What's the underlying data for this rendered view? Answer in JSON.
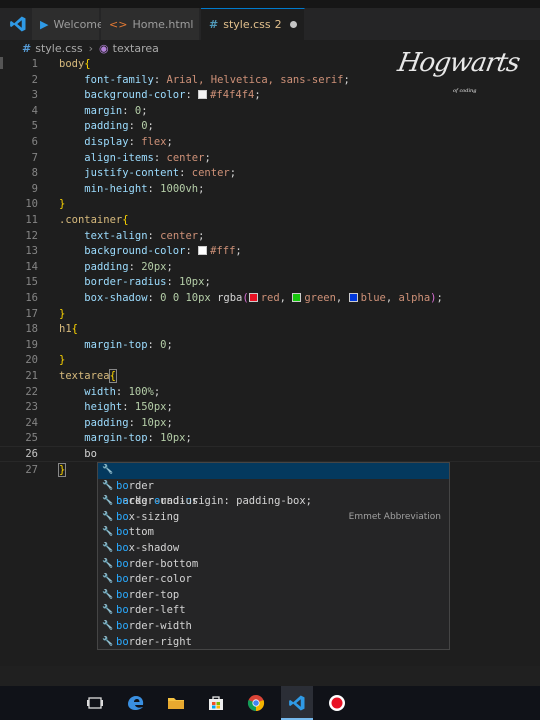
{
  "tabs": [
    {
      "label": "Welcome",
      "icon": "vscode-icon",
      "active": false
    },
    {
      "label": "Home.html",
      "icon": "html-icon",
      "active": false,
      "dirty": true
    },
    {
      "label": "style.css",
      "icon": "css-icon",
      "active": true,
      "badge": "2",
      "dirty": true
    }
  ],
  "breadcrumb": {
    "file": "style.css",
    "symbol": "textarea"
  },
  "watermark": {
    "title": "Hogwarts",
    "subtitle": "of coding"
  },
  "suggest": {
    "detail": "Emmet Abbreviation",
    "items": [
      {
        "prefix": "back",
        "hl": "",
        "rest": "ground-",
        "hl2": "o",
        "rest2": "rigin: padding-box;",
        "full": "background-origin: padding-box;"
      },
      {
        "hl": "bo",
        "rest": "rder"
      },
      {
        "hl": "bo",
        "rest": "rder-radius"
      },
      {
        "hl": "bo",
        "rest": "x-sizing"
      },
      {
        "hl": "bo",
        "rest": "ttom"
      },
      {
        "hl": "bo",
        "rest": "x-shadow"
      },
      {
        "hl": "bo",
        "rest": "rder-bottom"
      },
      {
        "hl": "bo",
        "rest": "rder-color"
      },
      {
        "hl": "bo",
        "rest": "rder-top"
      },
      {
        "hl": "bo",
        "rest": "rder-left"
      },
      {
        "hl": "bo",
        "rest": "rder-width"
      },
      {
        "hl": "bo",
        "rest": "rder-right"
      }
    ]
  },
  "code": {
    "l1": "body{",
    "l2p": "font-family",
    "l2v": "Arial, Helvetica, sans-serif",
    "l3p": "background-color",
    "l3v": "#f4f4f4",
    "l4p": "margin",
    "l4v": "0",
    "l5p": "padding",
    "l5v": "0",
    "l6p": "display",
    "l6v": "flex",
    "l7p": "align-items",
    "l7v": "center",
    "l8p": "justify-content",
    "l8v": "center",
    "l9p": "min-height",
    "l9v": "1000vh",
    "l10": "}",
    "l11": ".container{",
    "l12p": "text-align",
    "l12v": "center",
    "l13p": "background-color",
    "l13v": "#fff",
    "l14p": "padding",
    "l14v": "20px",
    "l15p": "border-radius",
    "l15v": "10px",
    "l16p": "box-shadow",
    "l17": "}",
    "l18": "h1{",
    "l19p": "margin-top",
    "l19v": "0",
    "l20": "}",
    "l21": "textarea{",
    "l22p": "width",
    "l22v": "100%",
    "l23p": "height",
    "l23v": "150px",
    "l24p": "padding",
    "l24v": "10px",
    "l25p": "margin-top",
    "l25v": "10px",
    "l26": "bo",
    "l27": "}"
  },
  "taskbar": [
    "task-view-icon",
    "edge-icon",
    "file-explorer-icon",
    "store-icon",
    "chrome-icon",
    "vscode-icon",
    "record-icon"
  ],
  "colors": {
    "accent": "#007acc",
    "background": "#1e1e1e"
  }
}
